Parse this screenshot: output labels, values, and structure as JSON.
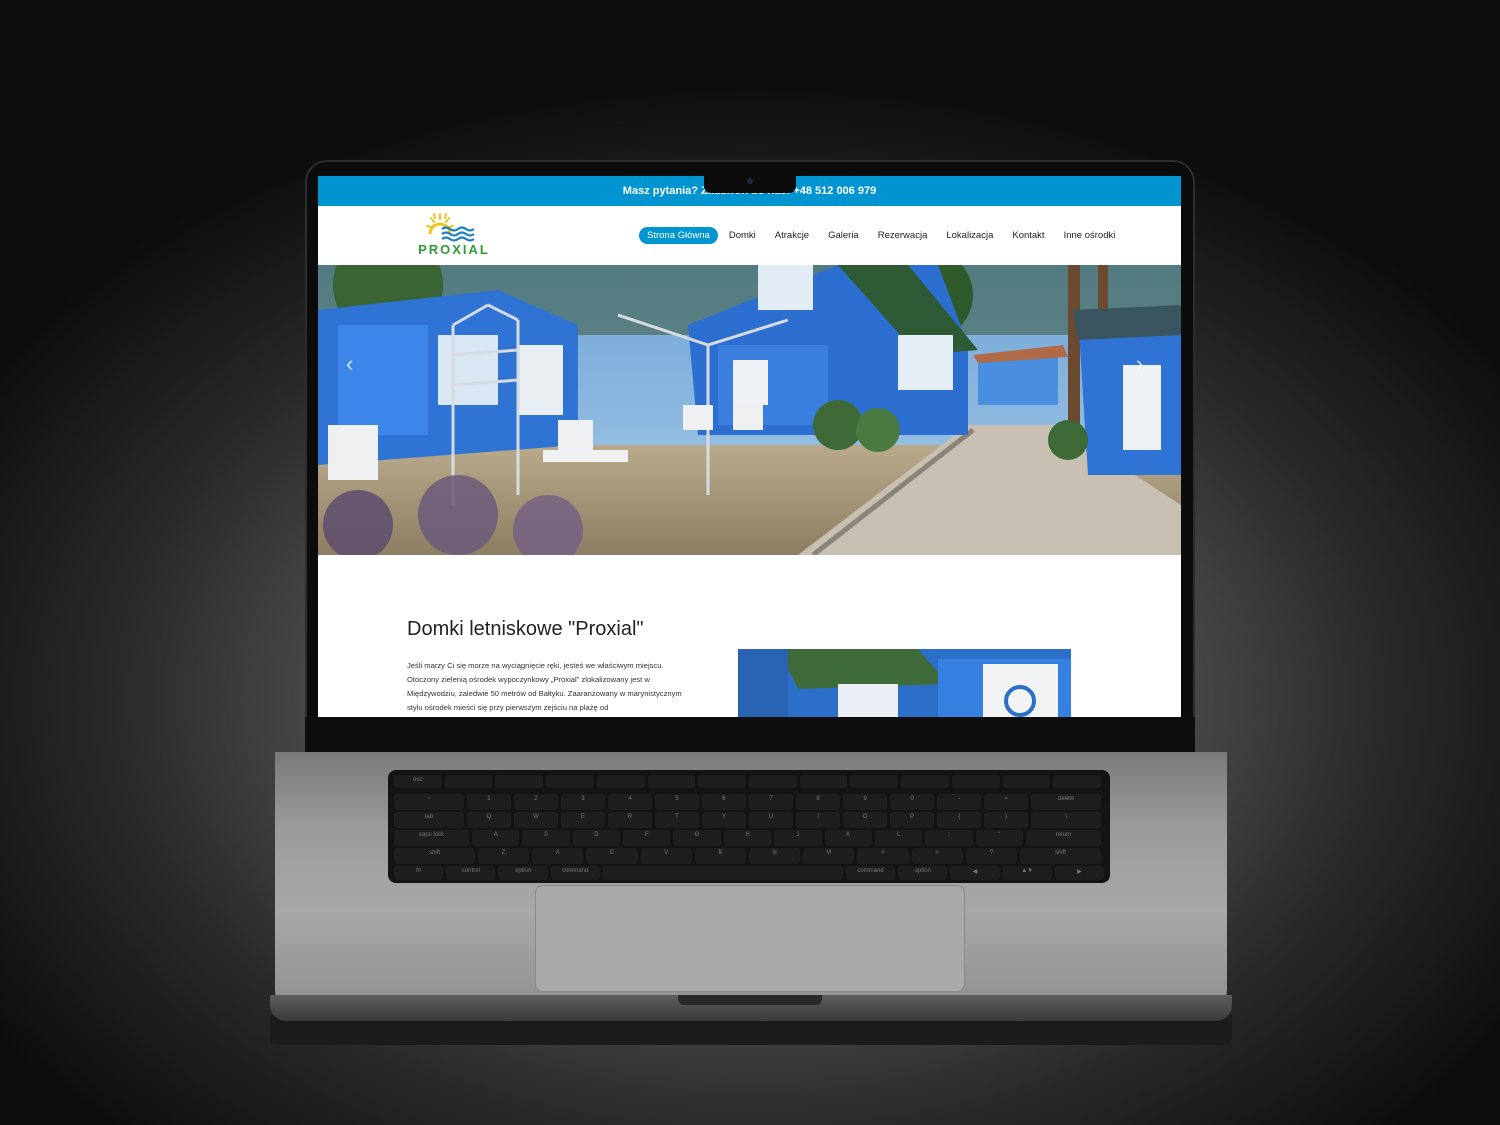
{
  "topbar": {
    "text": "Masz pytania? Zadzwoń do nas: +48 512 006 979"
  },
  "logo": {
    "text": "PROXIAL"
  },
  "nav": {
    "items": [
      "Strona Główna",
      "Domki",
      "Atrakcje",
      "Galeria",
      "Rezerwacja",
      "Lokalizacja",
      "Kontakt",
      "Inne ośrodki"
    ],
    "active_index": 0
  },
  "hero": {
    "prev_icon": "chevron-left-icon",
    "next_icon": "chevron-right-icon"
  },
  "intro": {
    "title": "Domki letniskowe \"Proxial\"",
    "text": "Jeśli marzy Ci się morze na wyciągnięcie ręki, jesteś we właściwym miejscu. Otoczony zielenią ośrodek wypoczynkowy „Proxial\" zlokalizowany jest w Międzywodziu, zaledwie 50 metrów od Bałtyku. Zaaranżowany w marynistycznym stylu ośrodek mieści się przy pierwszym zejściu na plażę od"
  },
  "keyboard": {
    "row1": [
      "esc",
      "",
      "",
      "",
      "",
      "",
      "",
      "",
      "",
      "",
      "",
      "",
      "",
      ""
    ],
    "row2": [
      "~",
      "1",
      "2",
      "3",
      "4",
      "5",
      "6",
      "7",
      "8",
      "9",
      "0",
      "-",
      "=",
      "delete"
    ],
    "row3": [
      "tab",
      "Q",
      "W",
      "E",
      "R",
      "T",
      "Y",
      "U",
      "I",
      "O",
      "P",
      "{",
      "}",
      "\\"
    ],
    "row4": [
      "caps lock",
      "A",
      "S",
      "D",
      "F",
      "G",
      "H",
      "J",
      "K",
      "L",
      ":",
      "\"",
      "return"
    ],
    "row5": [
      "shift",
      "Z",
      "X",
      "C",
      "V",
      "B",
      "N",
      "M",
      "<",
      ">",
      "?",
      "shift"
    ],
    "row6": [
      "fn",
      "control",
      "option",
      "command",
      "",
      "command",
      "option",
      "◀",
      "▲▼",
      "▶"
    ]
  },
  "colors": {
    "brand": "#0094d0",
    "logo_green": "#2f9b3a",
    "logo_sun": "#f2c418"
  }
}
